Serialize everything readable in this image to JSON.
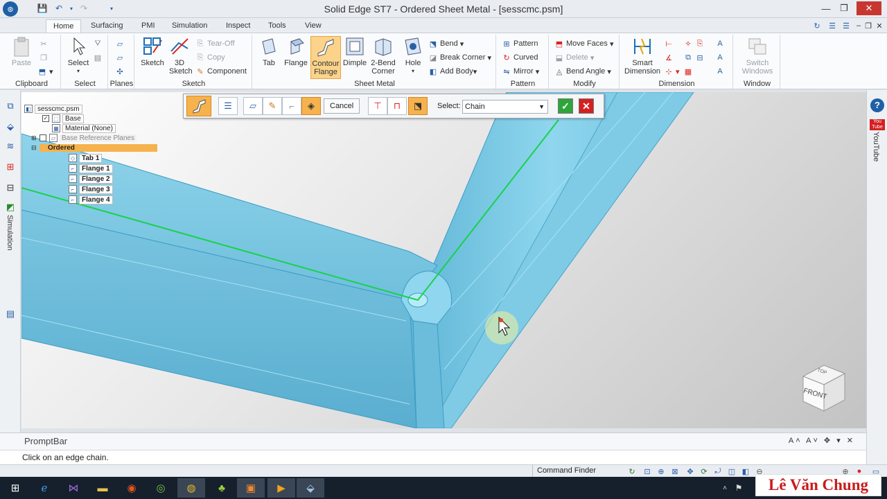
{
  "window": {
    "title": "Solid Edge ST7 - Ordered Sheet Metal - [sesscmc.psm]"
  },
  "tabs": [
    "Home",
    "Surfacing",
    "PMI",
    "Simulation",
    "Inspect",
    "Tools",
    "View"
  ],
  "ribbon": {
    "clipboard": {
      "label": "Clipboard",
      "paste": "Paste"
    },
    "select": {
      "label": "Select",
      "select_btn": "Select"
    },
    "planes": {
      "label": "Planes"
    },
    "sketch": {
      "label": "Sketch",
      "sketch_btn": "Sketch",
      "sketch3d_btn": "3D Sketch",
      "tearoff": "Tear-Off",
      "copy": "Copy",
      "component": "Component"
    },
    "sheet_metal": {
      "label": "Sheet Metal",
      "tab": "Tab",
      "flange": "Flange",
      "contour_flange": "Contour Flange",
      "dimple": "Dimple",
      "two_bend_corner": "2-Bend Corner",
      "hole": "Hole",
      "bend": "Bend",
      "break_corner": "Break Corner",
      "add_body": "Add Body"
    },
    "pattern": {
      "label": "Pattern",
      "pattern_btn": "Pattern",
      "curved": "Curved",
      "mirror": "Mirror"
    },
    "modify": {
      "label": "Modify",
      "move_faces": "Move Faces",
      "delete": "Delete",
      "bend_angle": "Bend Angle"
    },
    "dimension": {
      "label": "Dimension",
      "smart_dimension": "Smart Dimension"
    },
    "window": {
      "label": "Window",
      "switch_windows": "Switch Windows"
    }
  },
  "pathfinder": {
    "file": "sesscmc.psm",
    "base": "Base",
    "material": "Material (None)",
    "ref_planes": "Base Reference Planes",
    "ordered": "Ordered",
    "features": [
      "Tab 1",
      "Flange 1",
      "Flange 2",
      "Flange 3",
      "Flange 4"
    ]
  },
  "command_bar": {
    "cancel": "Cancel",
    "select_label": "Select:",
    "select_value": "Chain"
  },
  "view_cube": {
    "top": "TOP",
    "front": "FRONT"
  },
  "left_tabs": {
    "simulation": "Simulation"
  },
  "right_tabs": {
    "youtube": "YouTube"
  },
  "prompt": {
    "title": "PromptBar",
    "text": "Click on an edge chain."
  },
  "status": {
    "command_finder": "Command Finder"
  },
  "watermark": "Lê Văn Chung",
  "colors": {
    "part": "#7ec8e0",
    "edge_highlight": "#19d24a",
    "accent_orange": "#f6b24c",
    "ok": "#2da53a",
    "cancel": "#d42020"
  }
}
